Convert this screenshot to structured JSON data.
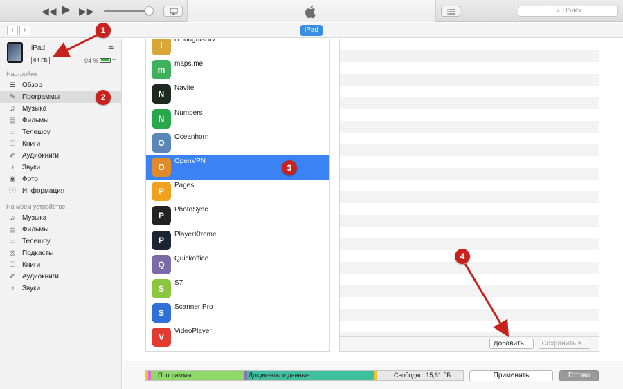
{
  "toolbar": {
    "search_placeholder": "Поиск",
    "ipad_tab": "iPad"
  },
  "device": {
    "name": "iPad",
    "capacity": "64 ГБ",
    "battery_text": "94 %",
    "battery_level": 0.94
  },
  "sidebar": {
    "settings_title": "Настройки",
    "settings_items": [
      {
        "label": "Обзор",
        "icon": "summary-icon"
      },
      {
        "label": "Программы",
        "icon": "apps-icon"
      },
      {
        "label": "Музыка",
        "icon": "music-icon"
      },
      {
        "label": "Фильмы",
        "icon": "movies-icon"
      },
      {
        "label": "Телешоу",
        "icon": "tv-icon"
      },
      {
        "label": "Книги",
        "icon": "books-icon"
      },
      {
        "label": "Аудиокниги",
        "icon": "audiobooks-icon"
      },
      {
        "label": "Звуки",
        "icon": "tones-icon"
      },
      {
        "label": "Фото",
        "icon": "photos-icon"
      },
      {
        "label": "Информация",
        "icon": "info-icon"
      }
    ],
    "device_title": "На моем устройстве",
    "device_items": [
      {
        "label": "Музыка",
        "icon": "music-icon"
      },
      {
        "label": "Фильмы",
        "icon": "movies-icon"
      },
      {
        "label": "Телешоу",
        "icon": "tv-icon"
      },
      {
        "label": "Подкасты",
        "icon": "podcasts-icon"
      },
      {
        "label": "Книги",
        "icon": "books-icon"
      },
      {
        "label": "Аудиокниги",
        "icon": "audiobooks-icon"
      },
      {
        "label": "Звуки",
        "icon": "tones-icon"
      }
    ]
  },
  "apps": [
    {
      "name": "iThoughtsHD",
      "color": "#d9a63a"
    },
    {
      "name": "maps.me",
      "color": "#3db25a"
    },
    {
      "name": "Navitel",
      "color": "#1f2a1f"
    },
    {
      "name": "Numbers",
      "color": "#27a84a"
    },
    {
      "name": "Oceanhorn",
      "color": "#5a87b8"
    },
    {
      "name": "OpenVPN",
      "color": "#e08a2a"
    },
    {
      "name": "Pages",
      "color": "#f0a21f"
    },
    {
      "name": "PhotoSync",
      "color": "#222222"
    },
    {
      "name": "PlayerXtreme",
      "color": "#1c2433"
    },
    {
      "name": "Quickoffice",
      "color": "#7a6aa8"
    },
    {
      "name": "S7",
      "color": "#8cc63e"
    },
    {
      "name": "Scanner Pro",
      "color": "#2f6fd6"
    },
    {
      "name": "VideoPlayer",
      "color": "#e23b30"
    }
  ],
  "files": {
    "add_button": "Добавить...",
    "save_button": "Сохранить в..."
  },
  "storage": {
    "apps_label": "Программы",
    "docs_label": "Документы и данные",
    "free_label": "Свободно: 15,61 ГБ"
  },
  "actions": {
    "apply": "Применить",
    "done": "Готово"
  },
  "annotations": [
    "1",
    "2",
    "3",
    "4"
  ],
  "colors": {
    "accent": "#3b83f5",
    "annotation": "#c9211e",
    "storage_apps": "#8fd86a",
    "storage_docs": "#3fbfa0"
  }
}
